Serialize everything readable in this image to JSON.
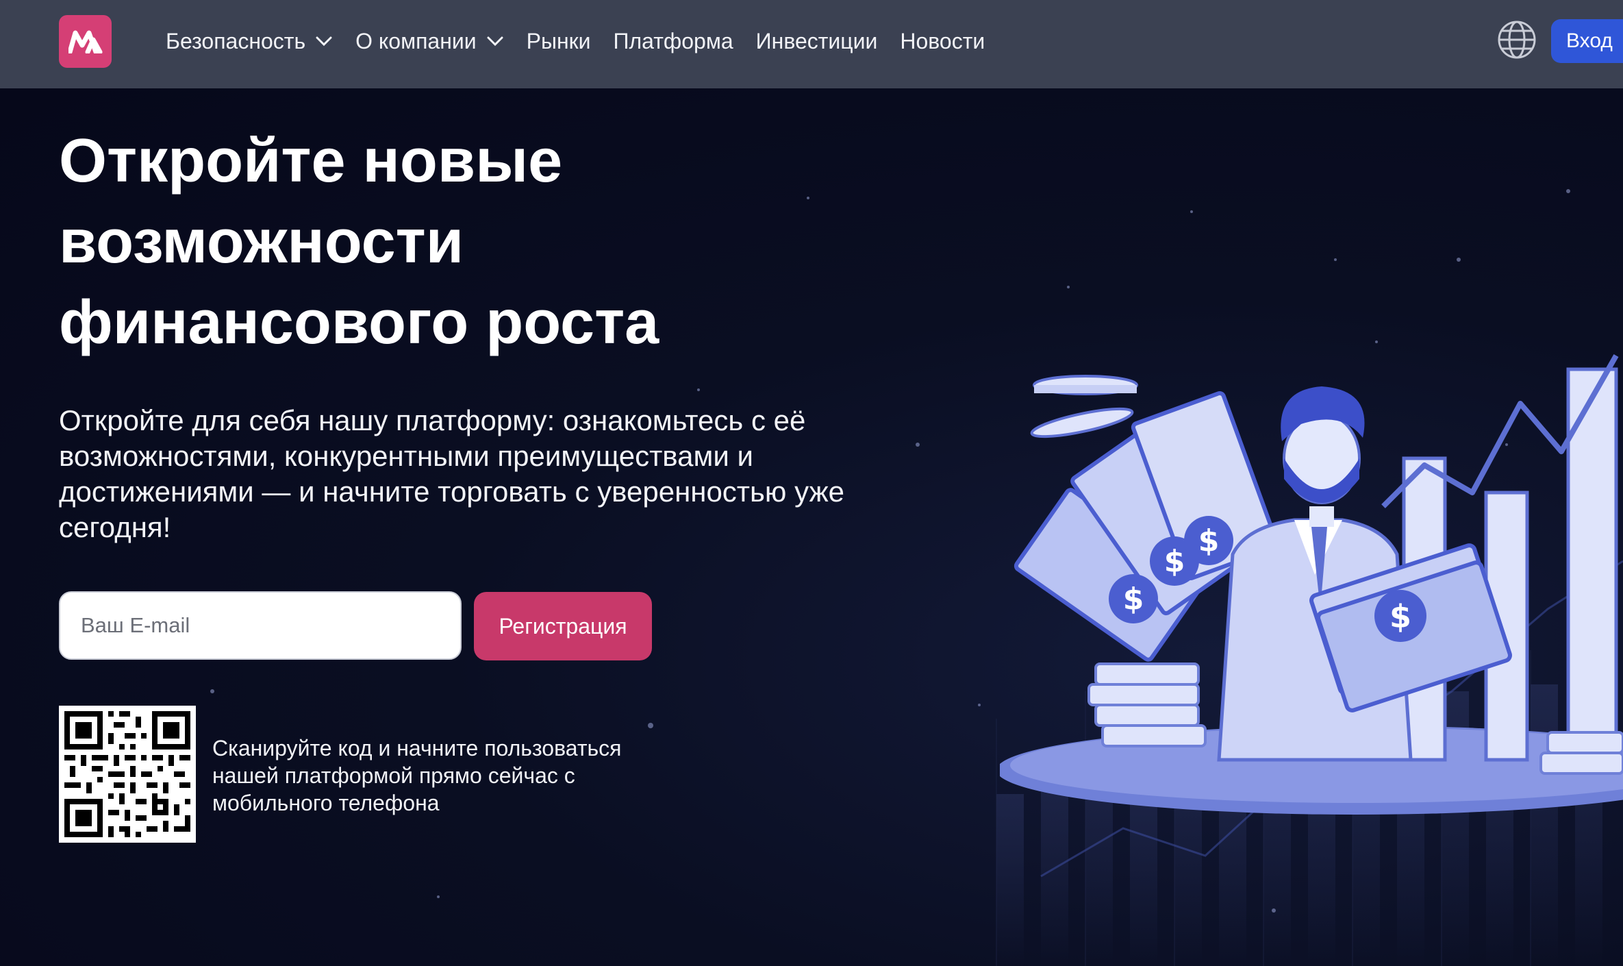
{
  "nav": {
    "items": [
      {
        "label": "Безопасность",
        "has_dropdown": true
      },
      {
        "label": "О компании",
        "has_dropdown": true
      },
      {
        "label": "Рынки",
        "has_dropdown": false
      },
      {
        "label": "Платформа",
        "has_dropdown": false
      },
      {
        "label": "Инвестиции",
        "has_dropdown": false
      },
      {
        "label": "Новости",
        "has_dropdown": false
      }
    ],
    "login_label": "Вход",
    "language_icon": "globe-icon",
    "logo_icon": "brand-logo"
  },
  "hero": {
    "title_lines": [
      "Откройте новые",
      "возможности",
      "финансового роста"
    ],
    "subtitle": "Откройте для себя нашу платформу: ознакомьтесь с её возможностями, конкурентными преимуществами и достижениями — и начните торговать с уверенностью уже сегодня!",
    "email_placeholder": "Ваш E-mail",
    "email_value": "",
    "register_label": "Регистрация",
    "qr_caption": "Сканируйте код и начните пользоваться нашей платформой прямо сейчас с мобильного телефона"
  },
  "colors": {
    "nav_bg": "#3b4152",
    "hero_bg": "#070a18",
    "brand": "#d53f75",
    "register_button": "#c8396a",
    "login_button": "#2f56d8",
    "illustration": "#7b8be0"
  }
}
